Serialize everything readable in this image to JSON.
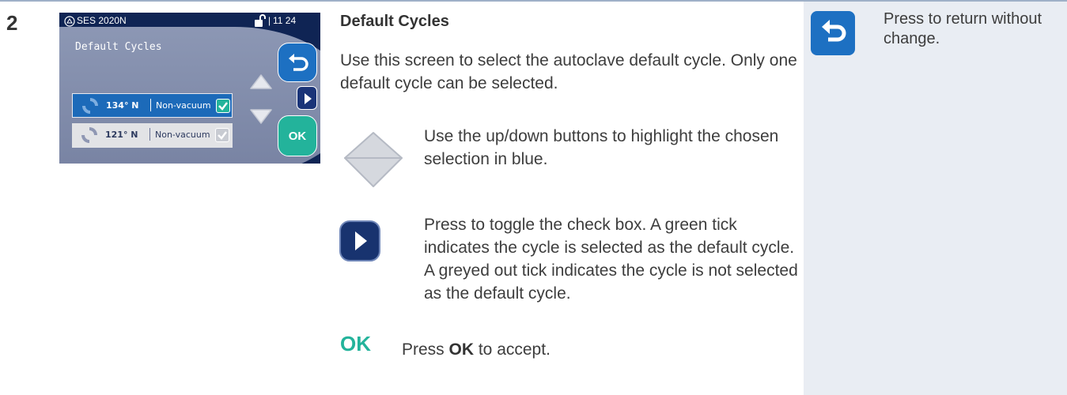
{
  "step_number": "2",
  "device_screen": {
    "model": "SES 2020N",
    "time": "11 24",
    "title": "Default Cycles",
    "rows": [
      {
        "temp": "134° N",
        "mode": "Non-vacuum",
        "checked": true
      },
      {
        "temp": "121° N",
        "mode": "Non-vacuum",
        "checked": false
      }
    ],
    "ok_label": "OK"
  },
  "section_title": "Default Cycles",
  "intro": "Use this screen to select the autoclave default cycle. Only one default cycle can be selected.",
  "updown_text": "Use the up/down buttons to highlight the chosen selection in blue.",
  "toggle_text": "Press to toggle the check box. A green tick indicates the cycle is selected as the default cycle. A greyed out tick indicates the cycle is not selected as the default cycle.",
  "ok_icon_label": "OK",
  "ok_press": "Press ",
  "ok_bold": "OK",
  "ok_rest": " to accept.",
  "return_text": "Press to return without change.",
  "colors": {
    "accent_blue": "#1d70c2",
    "navy": "#0f2454",
    "ok_green": "#23b39b",
    "side_panel": "#e9edf3"
  },
  "icons": [
    "autoclave-logo-icon",
    "unlock-icon",
    "cycle-refresh-icon",
    "check-icon",
    "back-arrow-icon",
    "play-icon",
    "up-arrow-icon",
    "down-arrow-icon"
  ]
}
